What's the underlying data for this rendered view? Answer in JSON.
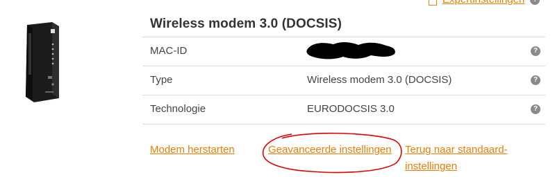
{
  "header": {
    "expert_link": "Expertinstellingen",
    "help": "?"
  },
  "device": {
    "title": "Wireless modem 3.0 (DOCSIS)"
  },
  "info": {
    "rows": [
      {
        "label": "MAC-ID",
        "value": "",
        "help": "?"
      },
      {
        "label": "Type",
        "value": "Wireless modem 3.0 (DOCSIS)",
        "help": "?"
      },
      {
        "label": "Technologie",
        "value": "EURODOCSIS 3.0",
        "help": "?"
      }
    ]
  },
  "actions": {
    "restart": "Modem herstarten",
    "advanced": "Geavanceerde instellingen",
    "reset": "Terug naar standaard-instellingen"
  },
  "colors": {
    "link": "#f07d00",
    "help_icon": "#8a8a8a",
    "annotation": "#e00000"
  }
}
